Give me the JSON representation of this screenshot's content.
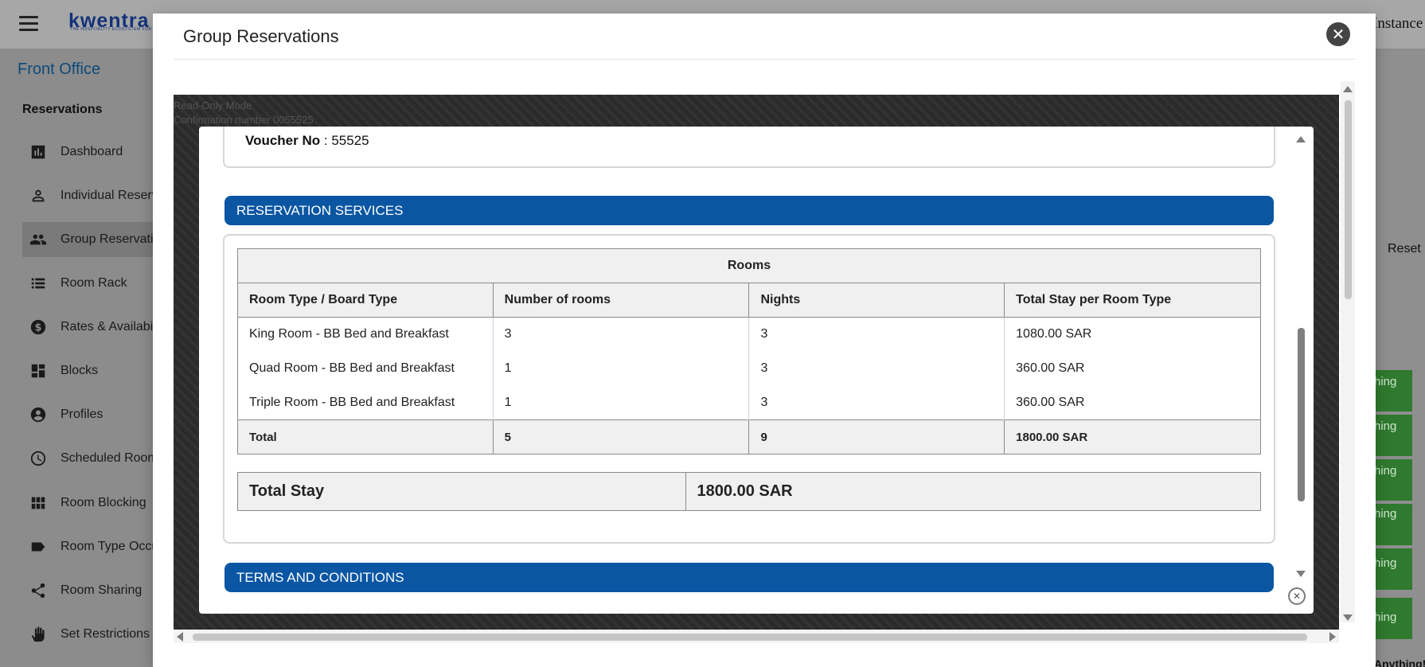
{
  "app": {
    "logo_text": "kwentra",
    "logo_tagline": "THE HOSPITALITY ECOSYSTEM FOR TOURISM",
    "instance_label": "Instance"
  },
  "sidebar": {
    "section_title": "Front Office",
    "group_title": "Reservations",
    "items": [
      {
        "label": "Dashboard",
        "icon": "bar-chart-icon"
      },
      {
        "label": "Individual Reservations",
        "icon": "person-icon"
      },
      {
        "label": "Group Reservations",
        "icon": "group-icon",
        "active": true
      },
      {
        "label": "Room Rack",
        "icon": "list-icon"
      },
      {
        "label": "Rates & Availability",
        "icon": "dollar-icon"
      },
      {
        "label": "Blocks",
        "icon": "dashboard-icon"
      },
      {
        "label": "Profiles",
        "icon": "account-circle-icon"
      },
      {
        "label": "Scheduled Rooms",
        "icon": "clock-icon"
      },
      {
        "label": "Room Blocking",
        "icon": "grid-icon"
      },
      {
        "label": "Room Type Occupancy",
        "icon": "label-icon"
      },
      {
        "label": "Room Sharing",
        "icon": "share-icon"
      },
      {
        "label": "Set Restrictions",
        "icon": "hand-icon"
      }
    ]
  },
  "background": {
    "reset_label": "Reset",
    "green_label": "hing",
    "footer_text": "Anything!",
    "ghost_line1": "Read-Only Mode",
    "ghost_line2": "Confirmation number 0055525"
  },
  "modal": {
    "title": "Group Reservations",
    "close_glyph": "✕"
  },
  "voucher": {
    "label": "Voucher No",
    "separator": " : ",
    "value": "55525"
  },
  "sections": {
    "services_title": "RESERVATION SERVICES",
    "terms_title": "TERMS AND CONDITIONS"
  },
  "rooms_table": {
    "caption": "Rooms",
    "headers": [
      "Room Type / Board Type",
      "Number of rooms",
      "Nights",
      "Total Stay per Room Type"
    ],
    "rows": [
      [
        "King Room - BB Bed and Breakfast",
        "3",
        "3",
        "1080.00 SAR"
      ],
      [
        "Quad Room - BB Bed and Breakfast",
        "1",
        "3",
        "360.00 SAR"
      ],
      [
        "Triple Room - BB Bed and Breakfast",
        "1",
        "3",
        "360.00 SAR"
      ]
    ],
    "total": [
      "Total",
      "5",
      "9",
      "1800.00 SAR"
    ]
  },
  "total_stay": {
    "label": "Total Stay",
    "value": "1800.00 SAR"
  },
  "colors": {
    "section_bar": "#0a56a3",
    "brand_navy": "#13327a",
    "sidebar_title": "#0d4a7a",
    "booking_green": "#2f7a2e"
  }
}
